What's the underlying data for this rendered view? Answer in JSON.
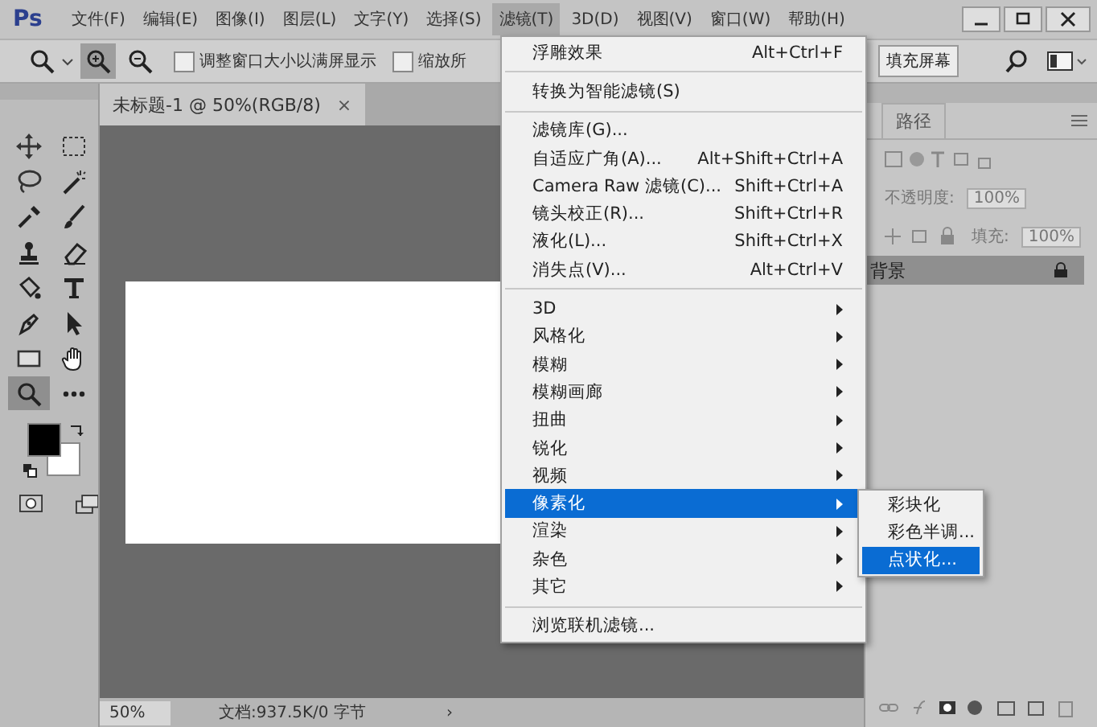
{
  "app": {
    "logo": "Ps"
  },
  "menu_bar": [
    {
      "label": "文件(F)",
      "selected": false
    },
    {
      "label": "编辑(E)",
      "selected": false
    },
    {
      "label": "图像(I)",
      "selected": false
    },
    {
      "label": "图层(L)",
      "selected": false
    },
    {
      "label": "文字(Y)",
      "selected": false
    },
    {
      "label": "选择(S)",
      "selected": false
    },
    {
      "label": "滤镜(T)",
      "selected": true
    },
    {
      "label": "3D(D)",
      "selected": false
    },
    {
      "label": "视图(V)",
      "selected": false
    },
    {
      "label": "窗口(W)",
      "selected": false
    },
    {
      "label": "帮助(H)",
      "selected": false
    }
  ],
  "options_bar": {
    "zoom_buttons": [
      {
        "kind": "zoom-in",
        "selected": true
      },
      {
        "kind": "zoom-out",
        "selected": false
      }
    ],
    "checkboxes": [
      {
        "label": "调整窗口大小以满屏显示",
        "checked": false
      },
      {
        "label": "缩放所",
        "checked": false
      }
    ],
    "fill_screen_button": "填充屏幕"
  },
  "document_tab": {
    "title": "未标题-1 @ 50%(RGB/8)",
    "close": "×"
  },
  "tools": [
    {
      "kind": "move",
      "selected": false
    },
    {
      "kind": "marquee",
      "selected": false
    },
    {
      "kind": "lasso",
      "selected": false
    },
    {
      "kind": "wand",
      "selected": false
    },
    {
      "kind": "eyedropper",
      "selected": false
    },
    {
      "kind": "brush",
      "selected": false
    },
    {
      "kind": "stamp",
      "selected": false
    },
    {
      "kind": "eraser",
      "selected": false
    },
    {
      "kind": "bucket",
      "selected": false
    },
    {
      "kind": "type",
      "selected": false
    },
    {
      "kind": "pen",
      "selected": false
    },
    {
      "kind": "cursor",
      "selected": false
    },
    {
      "kind": "rectangle",
      "selected": false
    },
    {
      "kind": "hand",
      "selected": false
    },
    {
      "kind": "zoom",
      "selected": true
    },
    {
      "kind": "more",
      "selected": false
    }
  ],
  "status_bar": {
    "zoom": "50%",
    "doc_info": "文档:937.5K/0 字节",
    "arrow": "›"
  },
  "layers_panel": {
    "tab": "路径",
    "opacity_label": "不透明度:",
    "opacity": "100%",
    "fill_label": "填充:",
    "fill": "100%",
    "layer": "背景"
  },
  "filter_menu": [
    {
      "kind": "item",
      "label": "浮雕效果",
      "shortcut": "Alt+Ctrl+F",
      "selected": false
    },
    {
      "kind": "separator"
    },
    {
      "kind": "item",
      "label": "转换为智能滤镜(S)",
      "selected": false
    },
    {
      "kind": "separator"
    },
    {
      "kind": "item",
      "label": "滤镜库(G)...",
      "selected": false
    },
    {
      "kind": "item",
      "label": "自适应广角(A)...",
      "shortcut": "Alt+Shift+Ctrl+A",
      "selected": false
    },
    {
      "kind": "item",
      "label": "Camera Raw 滤镜(C)...",
      "shortcut": "Shift+Ctrl+A",
      "selected": false
    },
    {
      "kind": "item",
      "label": "镜头校正(R)...",
      "shortcut": "Shift+Ctrl+R",
      "selected": false
    },
    {
      "kind": "item",
      "label": "液化(L)...",
      "shortcut": "Shift+Ctrl+X",
      "selected": false
    },
    {
      "kind": "item",
      "label": "消失点(V)...",
      "shortcut": "Alt+Ctrl+V",
      "selected": false
    },
    {
      "kind": "separator"
    },
    {
      "kind": "submenu",
      "label": "3D",
      "selected": false
    },
    {
      "kind": "submenu",
      "label": "风格化",
      "selected": false
    },
    {
      "kind": "submenu",
      "label": "模糊",
      "selected": false
    },
    {
      "kind": "submenu",
      "label": "模糊画廊",
      "selected": false
    },
    {
      "kind": "submenu",
      "label": "扭曲",
      "selected": false
    },
    {
      "kind": "submenu",
      "label": "锐化",
      "selected": false
    },
    {
      "kind": "submenu",
      "label": "视频",
      "selected": false
    },
    {
      "kind": "submenu",
      "label": "像素化",
      "selected": true
    },
    {
      "kind": "submenu",
      "label": "渲染",
      "selected": false
    },
    {
      "kind": "submenu",
      "label": "杂色",
      "selected": false
    },
    {
      "kind": "submenu",
      "label": "其它",
      "selected": false
    },
    {
      "kind": "separator"
    },
    {
      "kind": "item",
      "label": "浏览联机滤镜...",
      "selected": false
    }
  ],
  "pixelate_submenu": [
    {
      "label": "彩块化",
      "selected": false
    },
    {
      "label": "彩色半调...",
      "selected": false
    },
    {
      "label": "点状化...",
      "selected": true
    }
  ]
}
